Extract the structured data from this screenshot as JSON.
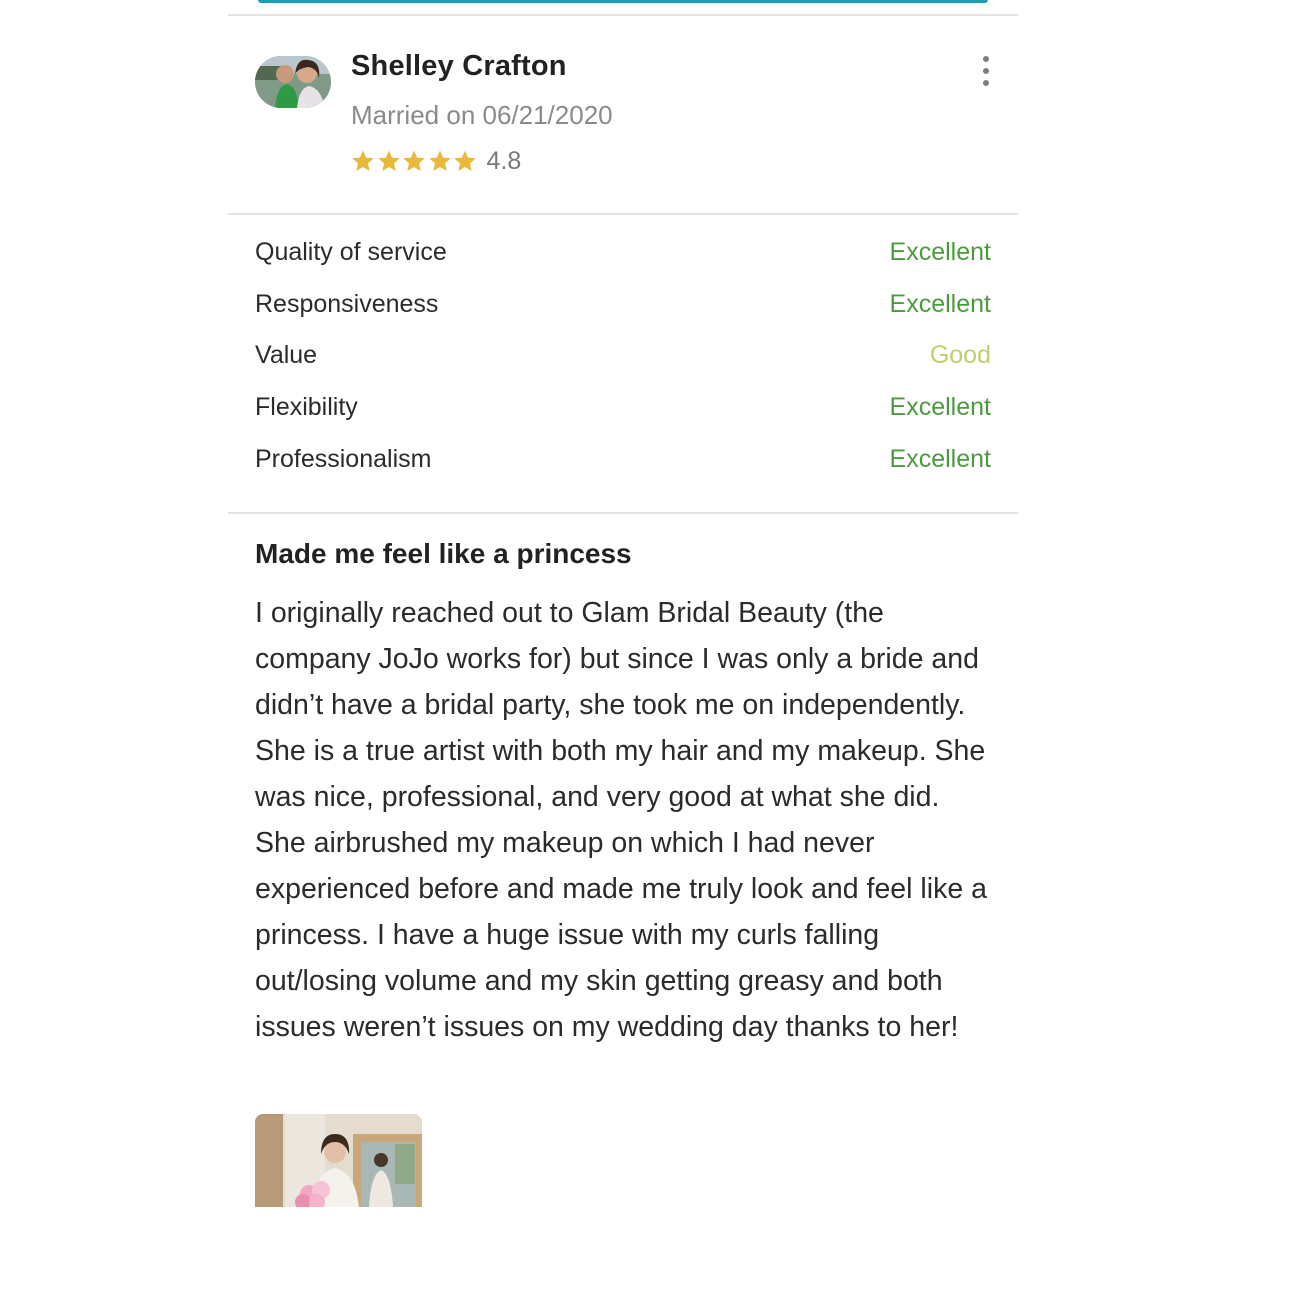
{
  "reviewer": {
    "name": "Shelley Crafton",
    "married_date": "Married on 06/21/2020",
    "rating": "4.8",
    "stars": 5
  },
  "ratings": [
    {
      "label": "Quality of service",
      "value": "Excellent",
      "color": "#4c9a3f"
    },
    {
      "label": "Responsiveness",
      "value": "Excellent",
      "color": "#4c9a3f"
    },
    {
      "label": "Value",
      "value": "Good",
      "color": "#bdd06b"
    },
    {
      "label": "Flexibility",
      "value": "Excellent",
      "color": "#4c9a3f"
    },
    {
      "label": "Professionalism",
      "value": "Excellent",
      "color": "#4c9a3f"
    }
  ],
  "review": {
    "title": "Made me feel like a princess",
    "body": "I originally reached out to Glam Bridal Beauty (the company JoJo works for) but since I was only a bride and didn’t have a bridal party, she took me on independently. She is a true artist with both my hair and my makeup. She was nice, professional, and very good at what she did. She airbrushed my makeup on which I had never experienced before and made me truly look and feel like a princess. I have a huge issue with my curls falling out/losing volume and my skin getting greasy and both issues weren’t issues on my wedding day thanks to her!"
  },
  "colors": {
    "accent": "#17a2b2",
    "star": "#e9b93a",
    "excellent": "#4c9a3f",
    "good": "#bdd06b"
  },
  "icons": {
    "more": "more-vertical-icon",
    "star": "star-icon"
  }
}
